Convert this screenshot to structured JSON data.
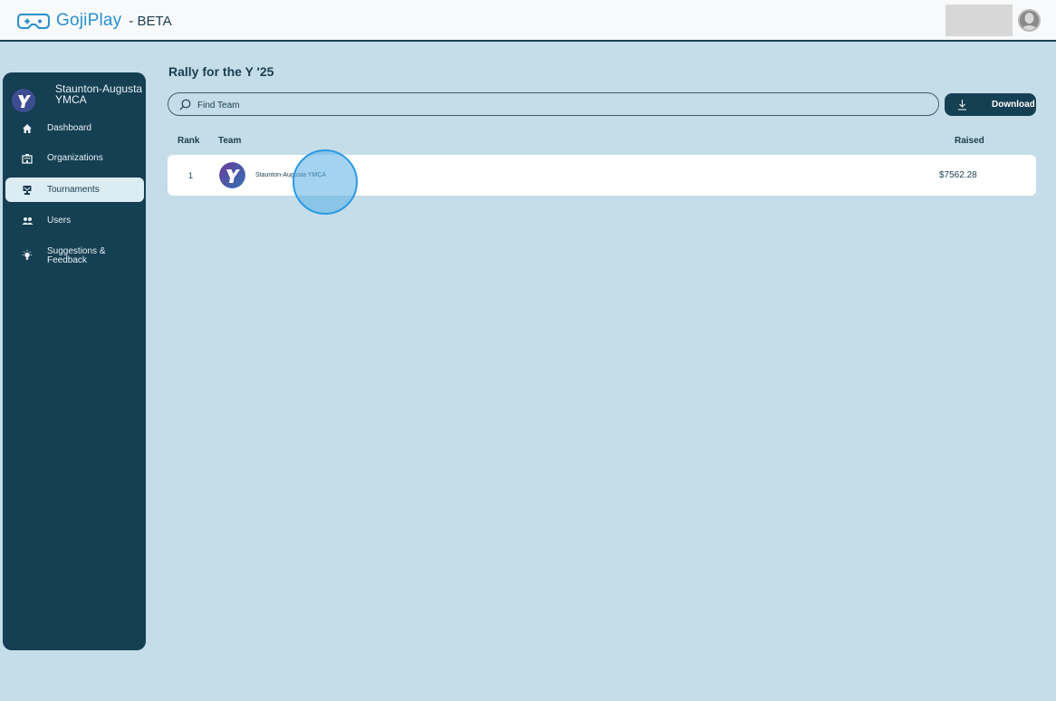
{
  "app": {
    "name": "GojiPlay",
    "suffix": "- BETA"
  },
  "sidebar": {
    "org_name": "Staunton-Augusta YMCA",
    "items": [
      {
        "label": "Dashboard",
        "icon": "home-icon"
      },
      {
        "label": "Organizations",
        "icon": "building-icon"
      },
      {
        "label": "Tournaments",
        "icon": "trophy-icon",
        "active": true
      },
      {
        "label": "Users",
        "icon": "users-icon"
      },
      {
        "label": "Suggestions & Feedback",
        "icon": "lightbulb-icon"
      }
    ]
  },
  "main": {
    "title": "Rally for the Y '25",
    "search": {
      "placeholder": "Find Team",
      "value": ""
    },
    "download_label": "Download",
    "columns": {
      "rank": "Rank",
      "team": "Team",
      "raised": "Raised"
    },
    "rows": [
      {
        "rank": "1",
        "team": "Staunton-Augusta YMCA",
        "raised": "$7562.28"
      }
    ]
  },
  "colors": {
    "background": "#c5dde9",
    "sidebar": "#153f52",
    "accent": "#2b8fd0",
    "active_nav": "#dcecf3"
  }
}
